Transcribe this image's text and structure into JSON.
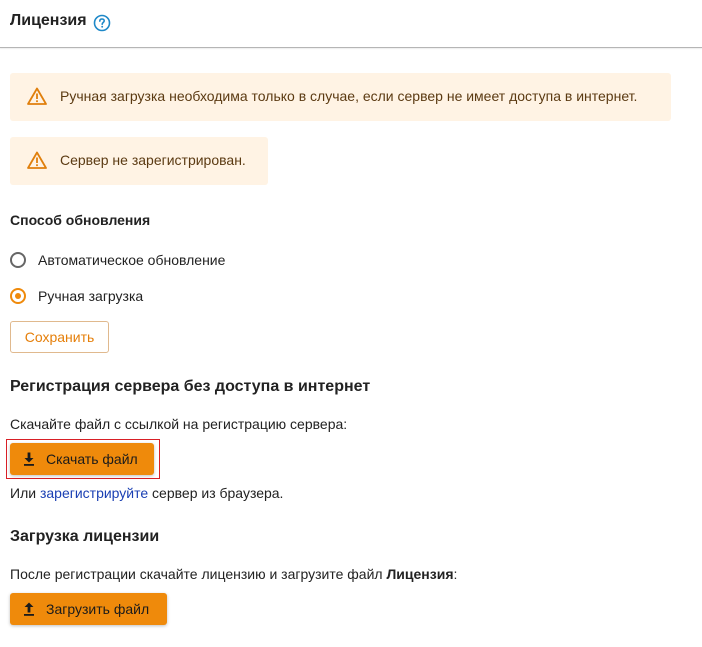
{
  "header": {
    "title": "Лицензия",
    "help_icon": "question-circle-icon"
  },
  "warnings": [
    {
      "icon": "warning-triangle-icon",
      "text": "Ручная загрузка необходима только в случае, если сервер не имеет доступа в интернет."
    },
    {
      "icon": "warning-triangle-icon",
      "text": "Сервер не зарегистрирован."
    }
  ],
  "update_method": {
    "label": "Способ обновления",
    "options": [
      {
        "label": "Автоматическое обновление",
        "selected": false
      },
      {
        "label": "Ручная загрузка",
        "selected": true
      }
    ],
    "save_label": "Сохранить"
  },
  "registration": {
    "title": "Регистрация сервера без доступа в интернет",
    "description": "Скачайте файл с ссылкой на регистрацию сервера:",
    "download_label": "Скачать файл",
    "download_icon": "download-icon",
    "alt_prefix": "Или ",
    "alt_link": "зарегистрируйте",
    "alt_suffix": " сервер из браузера."
  },
  "license_upload": {
    "title": "Загрузка лицензии",
    "description_prefix": "После регистрации скачайте лицензию и загрузите файл ",
    "description_bold": "Лицензия",
    "description_suffix": ":",
    "upload_label": "Загрузить файл",
    "upload_icon": "upload-icon"
  },
  "colors": {
    "accent": "#ef8a0b",
    "warning_bg": "#fff3e4",
    "link": "#1a3fb3",
    "focus_outline": "#d81f26"
  }
}
